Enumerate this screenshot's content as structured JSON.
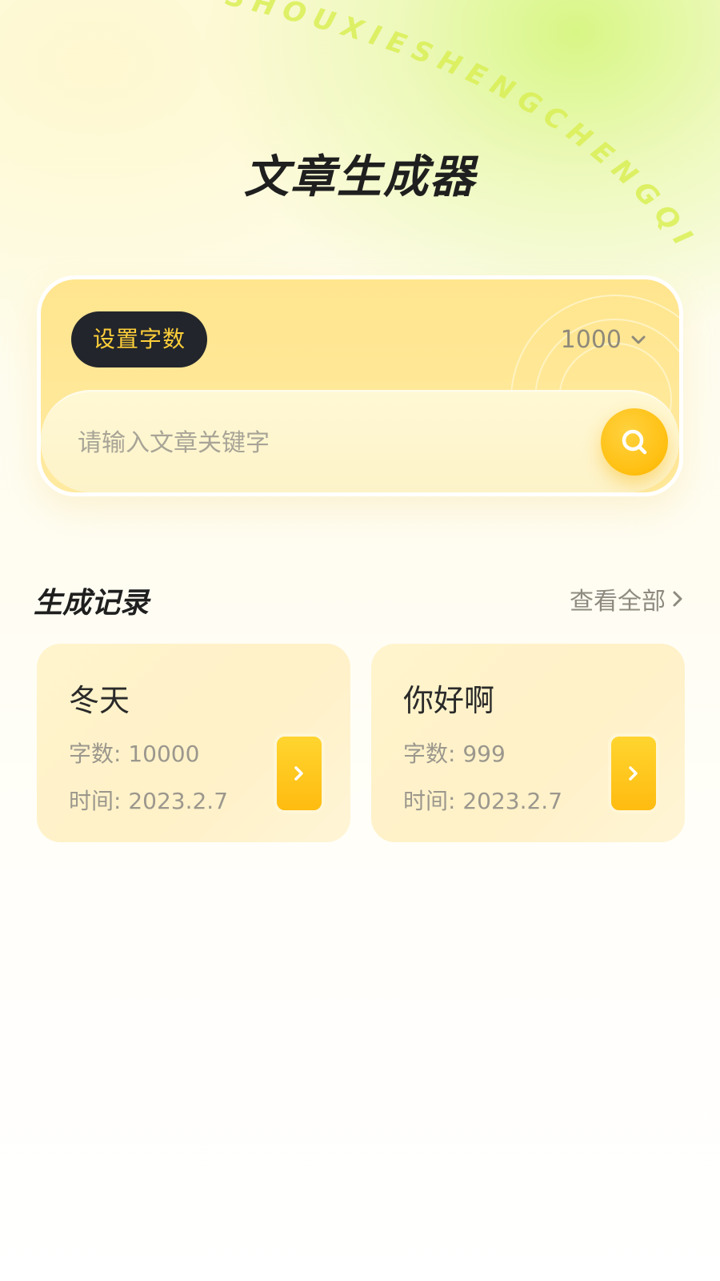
{
  "decor": {
    "arc_text": "SHOUXIESHENGCHENGQI"
  },
  "header": {
    "title": "文章生成器"
  },
  "generator": {
    "word_count_label": "设置字数",
    "word_count_value": "1000",
    "search_placeholder": "请输入文章关键字"
  },
  "records": {
    "section_title": "生成记录",
    "view_all_label": "查看全部",
    "items": [
      {
        "title": "冬天",
        "word_count": "字数: 10000",
        "time": "时间: 2023.2.7"
      },
      {
        "title": "你好啊",
        "word_count": "字数: 999",
        "time": "时间: 2023.2.7"
      }
    ]
  },
  "colors": {
    "accent": "#ffbf10",
    "pill_bg": "#22252b",
    "pill_text": "#ffcf3a",
    "card_bg": "#ffe58e"
  }
}
